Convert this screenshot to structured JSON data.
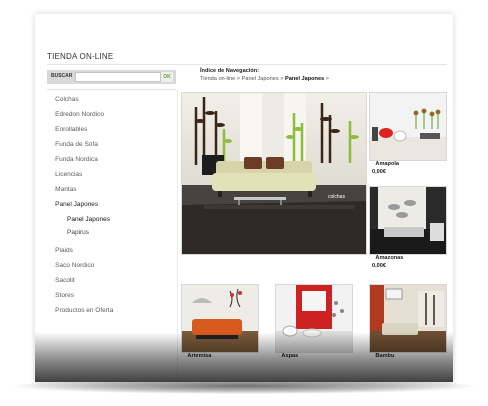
{
  "store": {
    "title": "TIENDA ON-LINE"
  },
  "search": {
    "label": "BUSCAR",
    "placeholder": "",
    "button": "OK"
  },
  "sidebar": {
    "items": [
      {
        "label": "Colchas"
      },
      {
        "label": "Edredon Nordico"
      },
      {
        "label": "Enrollables"
      },
      {
        "label": "Funda de Sofa"
      },
      {
        "label": "Funda Nordica"
      },
      {
        "label": "Licencias"
      },
      {
        "label": "Mantas"
      },
      {
        "label": "Panel Japones"
      },
      {
        "label": "Plaids"
      },
      {
        "label": "Saco Nordico"
      },
      {
        "label": "Sacolit"
      },
      {
        "label": "Stores"
      },
      {
        "label": "Productos en Oferta"
      }
    ],
    "subitems": [
      {
        "label": "Panel Japones"
      },
      {
        "label": "Papirus"
      }
    ]
  },
  "breadcrumb": {
    "title": "Índice de Navegación:",
    "path1": "Tienda on-line",
    "sep1": " > ",
    "path2": "Panel Japones",
    "sep2": " > ",
    "current": "Panel Japones",
    "sep3": " >"
  },
  "products": [
    {
      "name": "Amapola",
      "price": "0,00€"
    },
    {
      "name": "Amazonas",
      "price": "0,00€"
    },
    {
      "name": "Artemisa",
      "price": ""
    },
    {
      "name": "Aspas",
      "price": ""
    },
    {
      "name": "Bambu",
      "price": ""
    }
  ],
  "hero": {
    "brand_text": "colchas"
  },
  "colors": {
    "accent": "#a7c95a",
    "ok_green": "#63a52a"
  }
}
